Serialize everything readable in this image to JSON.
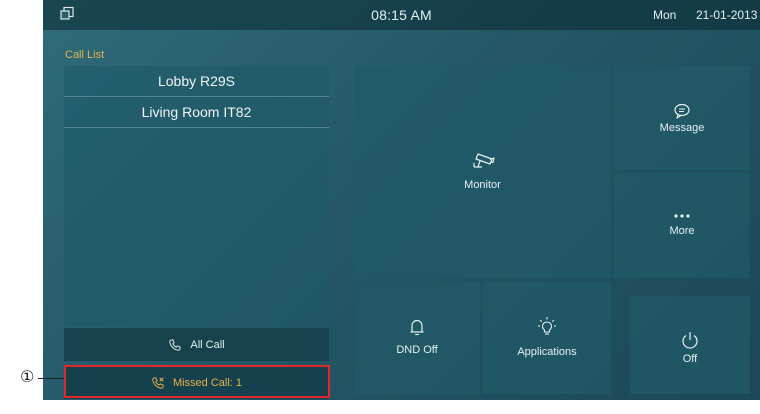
{
  "status_bar": {
    "time": "08:15 AM",
    "day": "Mon",
    "date": "21-01-2013",
    "left_icon": "window-restore-icon"
  },
  "call_list": {
    "title": "Call List",
    "items": [
      {
        "label": "Lobby R29S"
      },
      {
        "label": "Living Room IT82"
      }
    ],
    "all_call_label": "All Call",
    "missed_call_label": "Missed Call: 1"
  },
  "tiles": {
    "monitor": {
      "label": "Monitor",
      "icon": "camera-icon"
    },
    "message": {
      "label": "Message",
      "icon": "chat-bubble-icon"
    },
    "more": {
      "label": "More",
      "icon": "more-dots-icon"
    },
    "dnd": {
      "label": "DND Off",
      "icon": "bell-icon"
    },
    "applications": {
      "label": "Applications",
      "icon": "lightbulb-icon"
    },
    "off": {
      "label": "Off",
      "icon": "power-icon"
    }
  },
  "annotation": {
    "number": "①"
  },
  "colors": {
    "accent": "#e7b24a",
    "highlight": "#e0282e",
    "text": "#e6f0f2"
  }
}
